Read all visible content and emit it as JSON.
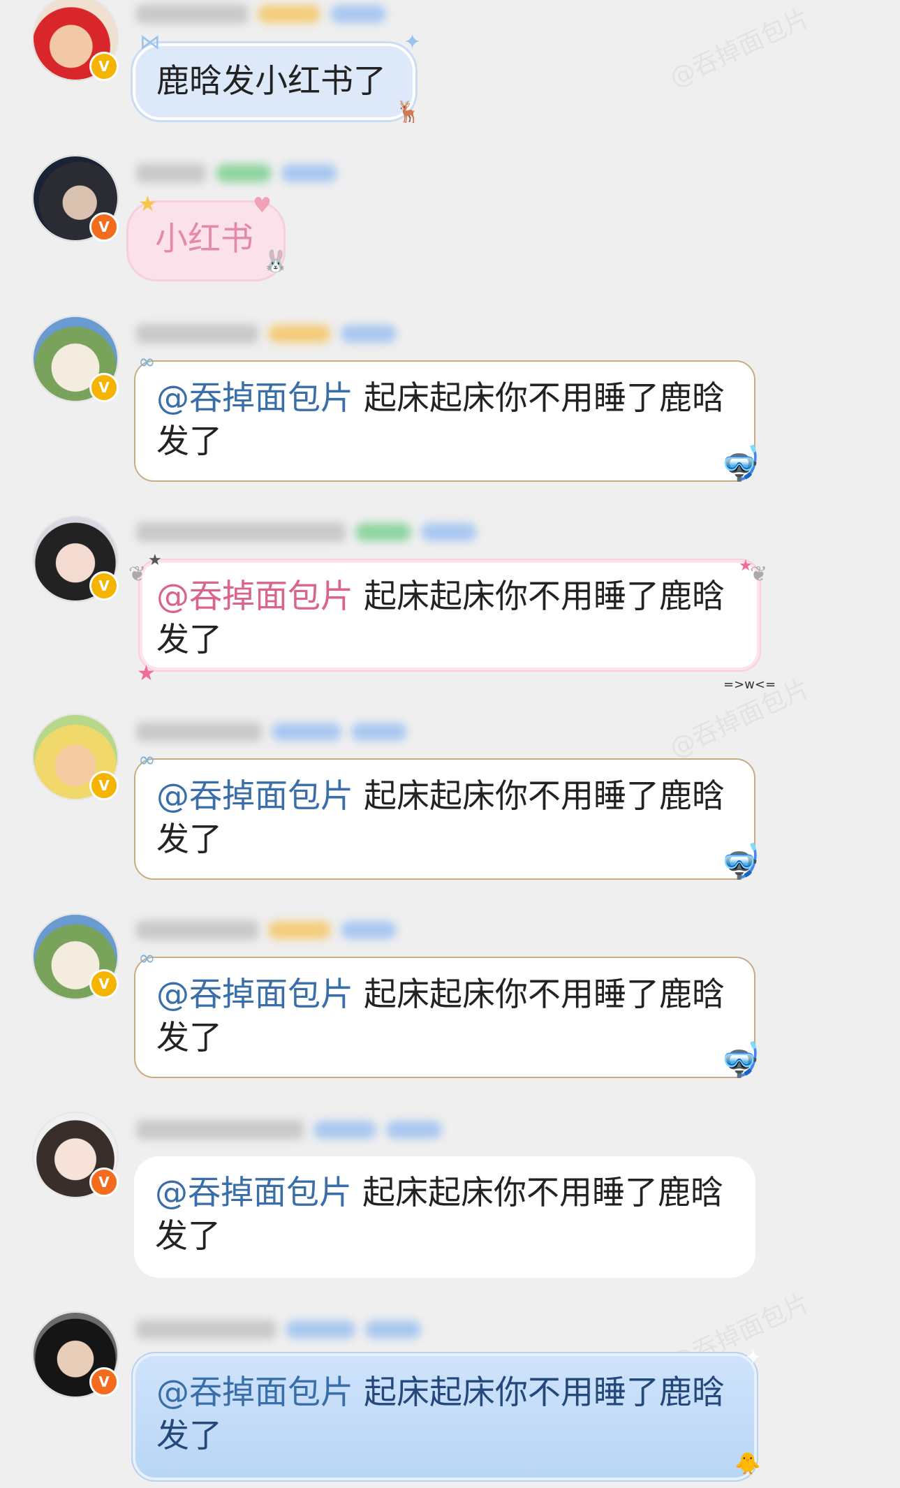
{
  "messages": [
    {
      "text": "鹿晗发小红书了",
      "badge": "V",
      "style": "blue"
    },
    {
      "text": "小红书",
      "badge": "V",
      "style": "pink"
    },
    {
      "mention": "@吞掉面包片",
      "text_line1": "起床起床你不用睡了鹿晗",
      "text_line2": "发了",
      "badge": "V",
      "style": "plain"
    },
    {
      "mention": "@吞掉面包片",
      "text_line1": "起床起床你不用睡了鹿晗",
      "text_line2": "发了",
      "badge": "V",
      "style": "glow"
    },
    {
      "mention": "@吞掉面包片",
      "text_line1": "起床起床你不用睡了鹿晗",
      "text_line2": "发了",
      "badge": "V",
      "style": "plain"
    },
    {
      "mention": "@吞掉面包片",
      "text_line1": "起床起床你不用睡了鹿晗",
      "text_line2": "发了",
      "badge": "V",
      "style": "plain"
    },
    {
      "mention": "@吞掉面包片",
      "text_line1": "起床起床你不用睡了鹿晗",
      "text_line2": "发了",
      "badge": "V",
      "style": "white"
    },
    {
      "mention": "@吞掉面包片",
      "text_line1": "起床起床你不用睡了鹿晗",
      "text_line2": "发了",
      "badge": "V",
      "style": "sky"
    }
  ],
  "watermark": "@吞掉面包片",
  "decor_emote": "=>w<=",
  "colors": {
    "mention": "#3a6ea8",
    "mention_pink": "#d9658a",
    "background": "#efefef"
  }
}
